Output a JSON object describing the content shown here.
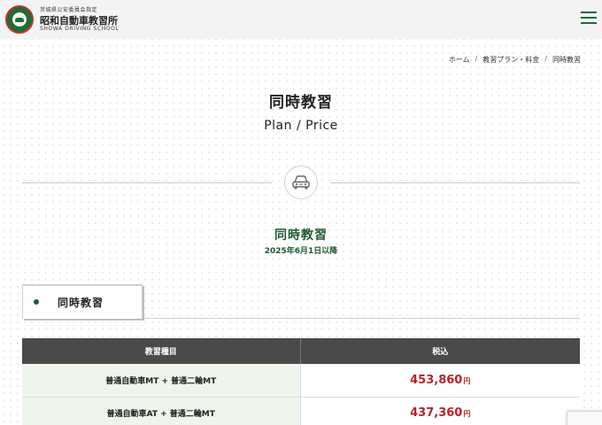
{
  "header": {
    "designation": "茨城県公安委員会指定",
    "school_name": "昭和自動車教習所",
    "school_name_en": "SHOWA DRIVING SCHOOL",
    "logo_icon": "school-emblem-icon",
    "menu_icon": "hamburger-menu-icon",
    "brand_color": "#1f6b3a"
  },
  "breadcrumb": {
    "items": [
      "ホーム",
      "教習プラン・料金",
      "同時教習"
    ],
    "separator": "/"
  },
  "page": {
    "title": "同時教習",
    "subtitle": "Plan / Price"
  },
  "divider_icon": "car-icon",
  "section": {
    "title": "同時教習",
    "effective_date": "2025年6月1日以降",
    "accent_color": "#1e5a30"
  },
  "tabs": [
    {
      "label": "同時教習",
      "active": true
    }
  ],
  "price_table": {
    "headers": [
      "教習種目",
      "税込"
    ],
    "rows": [
      {
        "course": "普通自動車MT + 普通二輪MT",
        "price": "453,860",
        "unit": "円"
      },
      {
        "course": "普通自動車AT + 普通二輪MT",
        "price": "437,360",
        "unit": "円"
      }
    ],
    "price_color": "#b8222a"
  }
}
